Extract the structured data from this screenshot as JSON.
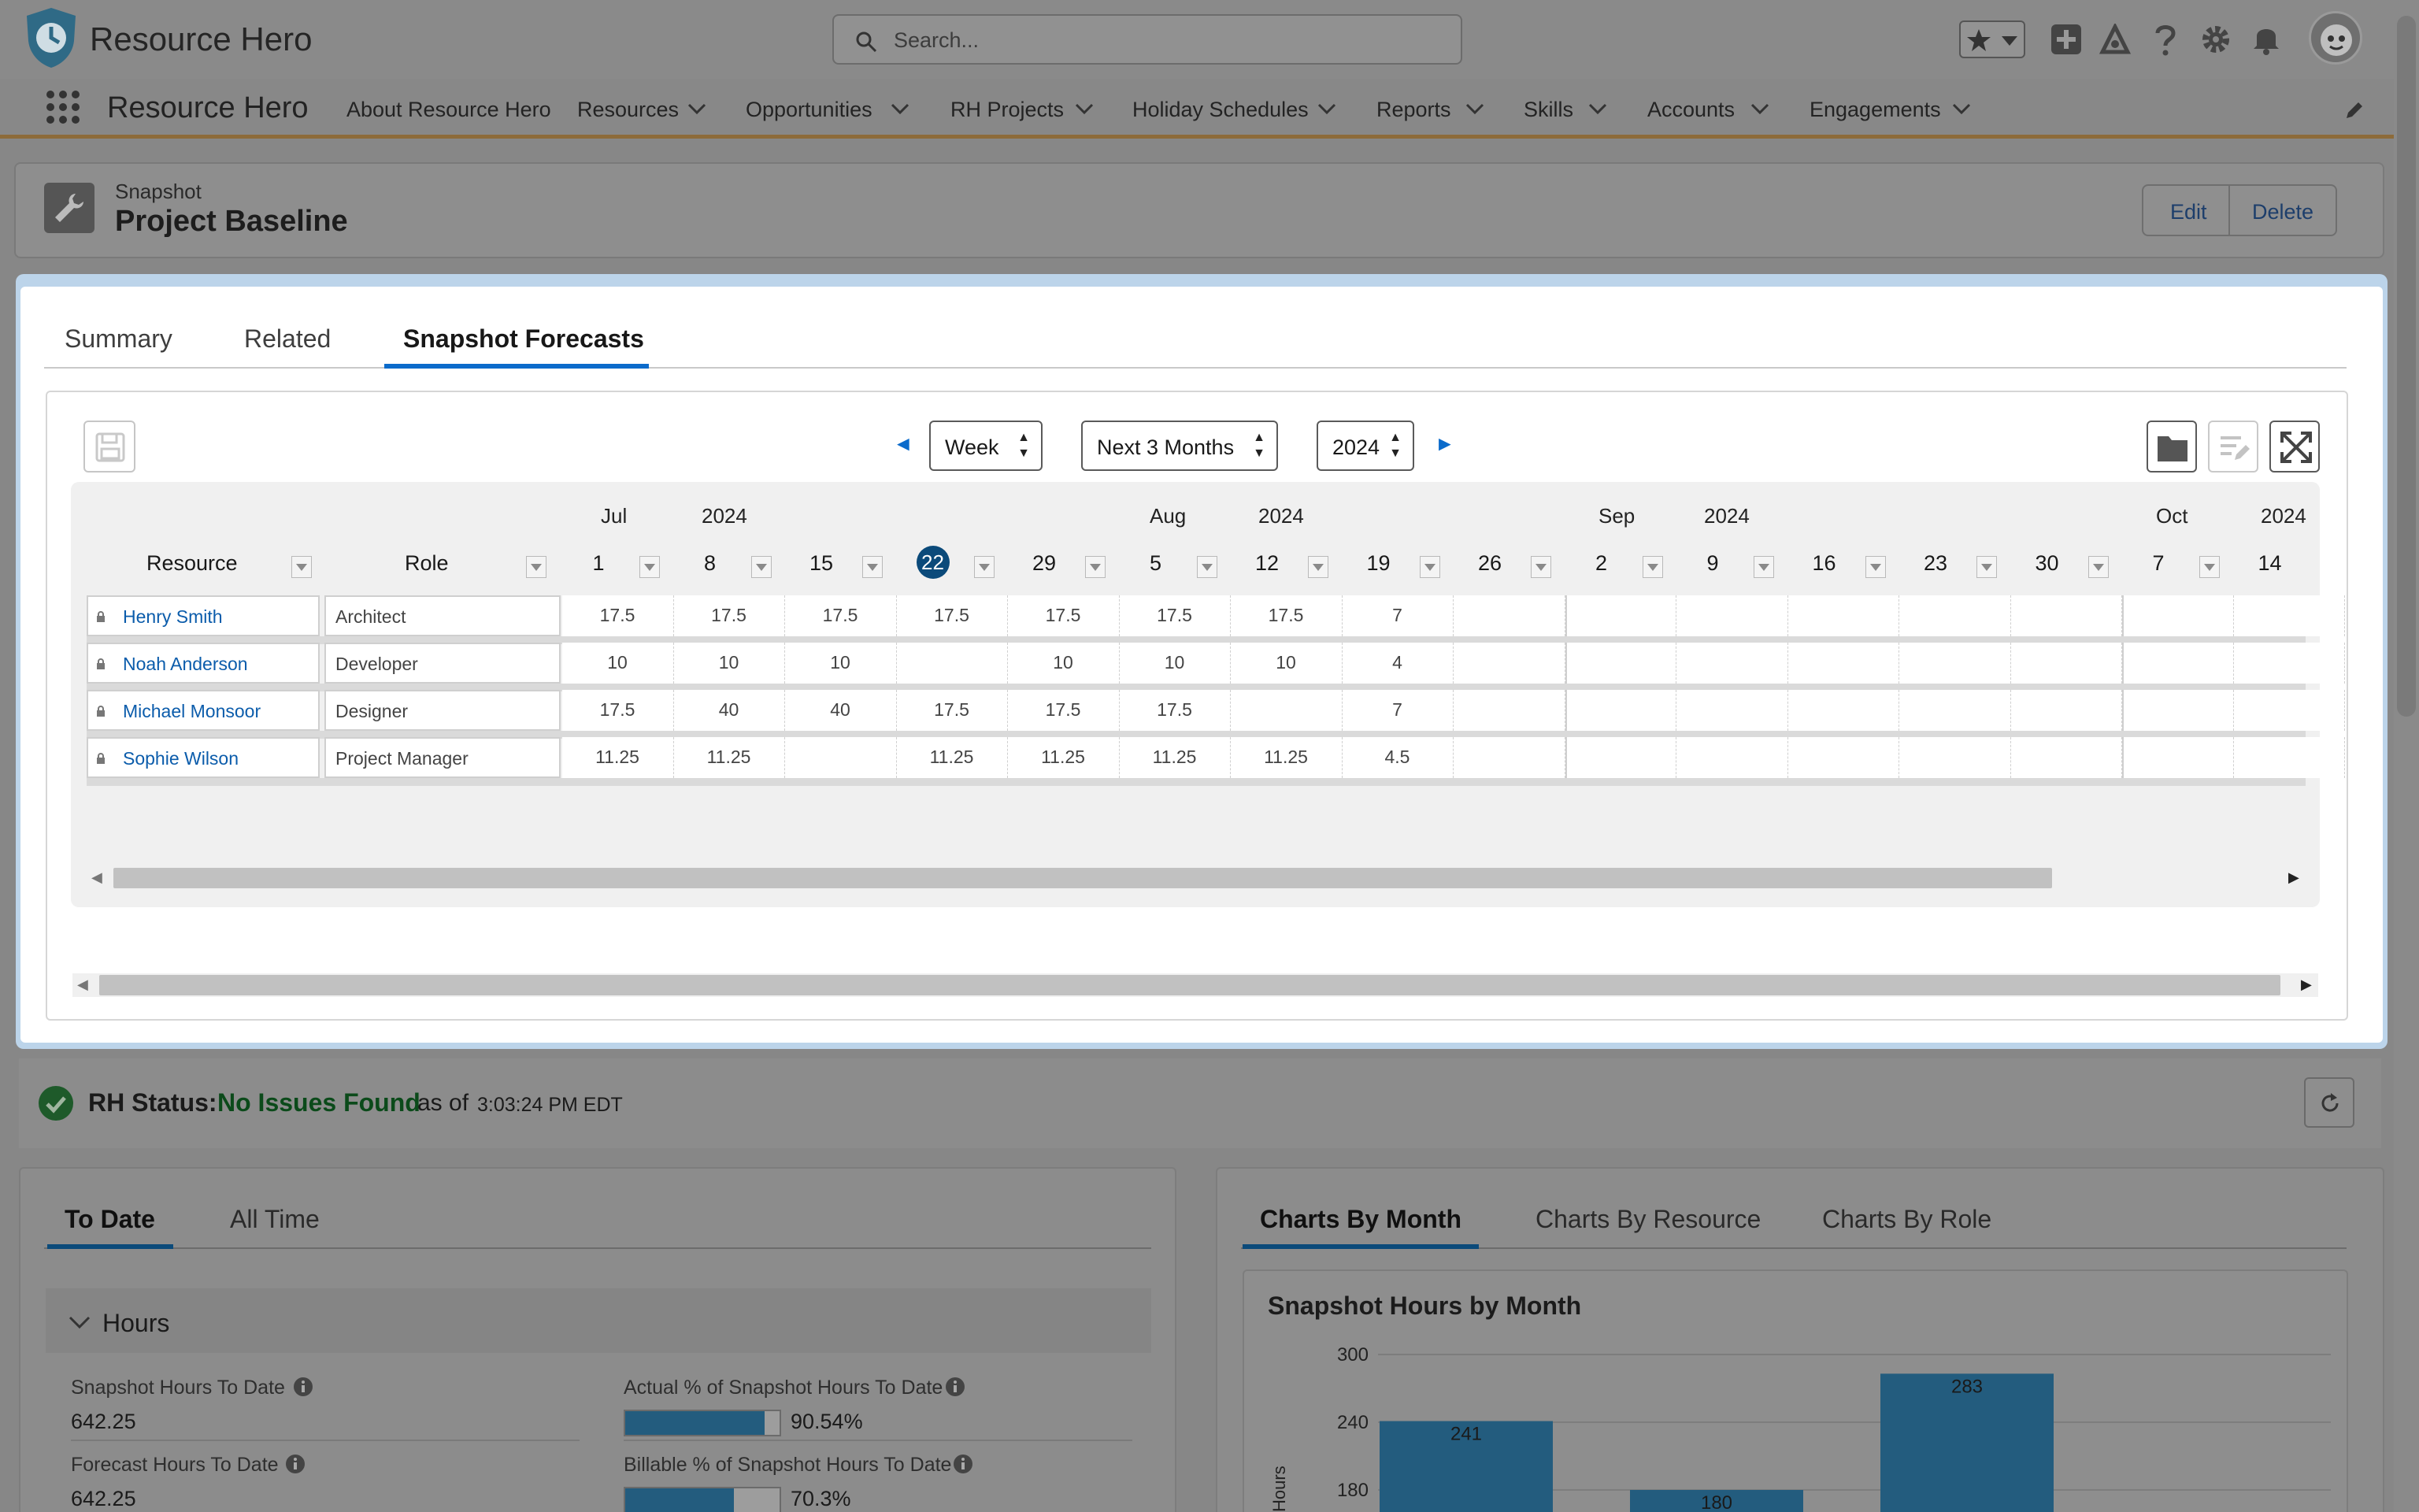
{
  "app": {
    "brand": "Resource Hero",
    "nav_title": "Resource Hero"
  },
  "search": {
    "placeholder": "Search..."
  },
  "nav": {
    "items": [
      {
        "label": "About Resource Hero"
      },
      {
        "label": "Resources"
      },
      {
        "label": "Opportunities"
      },
      {
        "label": "RH Projects"
      },
      {
        "label": "Holiday Schedules"
      },
      {
        "label": "Reports"
      },
      {
        "label": "Skills"
      },
      {
        "label": "Accounts"
      },
      {
        "label": "Engagements"
      }
    ]
  },
  "record": {
    "object": "Snapshot",
    "name": "Project Baseline",
    "edit": "Edit",
    "delete": "Delete"
  },
  "tabs": [
    "Summary",
    "Related",
    "Snapshot Forecasts"
  ],
  "toolbar": {
    "period": "Week",
    "range": "Next 3 Months",
    "year": "2024"
  },
  "grid": {
    "months": [
      {
        "m": "Jul",
        "y": "2024"
      },
      {
        "m": "Aug",
        "y": "2024"
      },
      {
        "m": "Sep",
        "y": "2024"
      },
      {
        "m": "Oct",
        "y": "2024"
      }
    ],
    "col_resource": "Resource",
    "col_role": "Role",
    "weeks": [
      "1",
      "8",
      "15",
      "22",
      "29",
      "5",
      "12",
      "19",
      "26",
      "2",
      "9",
      "16",
      "23",
      "30",
      "7",
      "14"
    ],
    "today_week": "22",
    "rows": [
      {
        "resource": "Henry Smith",
        "role": "Architect",
        "values": [
          "17.5",
          "17.5",
          "17.5",
          "17.5",
          "17.5",
          "17.5",
          "17.5",
          "7",
          "",
          "",
          "",
          "",
          "",
          "",
          "",
          ""
        ]
      },
      {
        "resource": "Noah Anderson",
        "role": "Developer",
        "values": [
          "10",
          "10",
          "10",
          "",
          "10",
          "10",
          "10",
          "4",
          "",
          "",
          "",
          "",
          "",
          "",
          "",
          ""
        ]
      },
      {
        "resource": "Michael Monsoor",
        "role": "Designer",
        "values": [
          "17.5",
          "40",
          "40",
          "17.5",
          "17.5",
          "17.5",
          "",
          "7",
          "",
          "",
          "",
          "",
          "",
          "",
          "",
          ""
        ]
      },
      {
        "resource": "Sophie Wilson",
        "role": "Project Manager",
        "values": [
          "11.25",
          "11.25",
          "",
          "11.25",
          "11.25",
          "11.25",
          "11.25",
          "4.5",
          "",
          "",
          "",
          "",
          "",
          "",
          "",
          ""
        ]
      }
    ]
  },
  "status": {
    "label": "RH Status:",
    "value": "No Issues Found",
    "as_of": "as of",
    "time": "3:03:24 PM EDT"
  },
  "left_tabs": [
    "To Date",
    "All Time"
  ],
  "hours": {
    "section": "Hours",
    "snapshot_label": "Snapshot Hours To Date",
    "snapshot_value": "642.25",
    "forecast_label": "Forecast Hours To Date",
    "forecast_value": "642.25",
    "actual_pct_label": "Actual % of Snapshot Hours To Date",
    "actual_pct": "90.54%",
    "actual_fill": 0.9054,
    "billable_pct_label": "Billable % of Snapshot Hours To Date",
    "billable_pct": "70.3%",
    "billable_fill": 0.703
  },
  "right_tabs": [
    "Charts By Month",
    "Charts By Resource",
    "Charts By Role"
  ],
  "chart_data": {
    "type": "bar",
    "title": "Snapshot Hours by Month",
    "ylabel": "Hours",
    "yticks": [
      300,
      240,
      180
    ],
    "ylim": [
      0,
      300
    ],
    "values": [
      241,
      180,
      283
    ],
    "data_labels": [
      "241",
      "180",
      "283"
    ],
    "color": "#235c7e"
  }
}
